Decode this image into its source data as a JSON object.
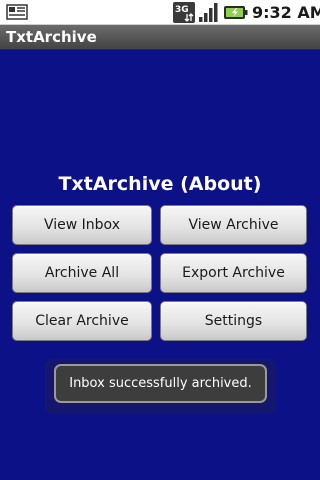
{
  "status_bar": {
    "time": "9:32 AM",
    "network_label": "3G",
    "icons": [
      "notification-icon",
      "3g-data-icon",
      "signal-strength-icon",
      "battery-charging-icon"
    ]
  },
  "app": {
    "title": "TxtArchive"
  },
  "main": {
    "heading": "TxtArchive (About)",
    "buttons": {
      "view_inbox": "View Inbox",
      "view_archive": "View Archive",
      "archive_all": "Archive All",
      "export_archive": "Export Archive",
      "clear_archive": "Clear Archive",
      "settings": "Settings"
    }
  },
  "toast": {
    "message": "Inbox successfully archived."
  },
  "colors": {
    "background": "#0d1187",
    "title_bar": "#555555",
    "button": "#e4e4e4",
    "toast": "#3d3d3d"
  }
}
